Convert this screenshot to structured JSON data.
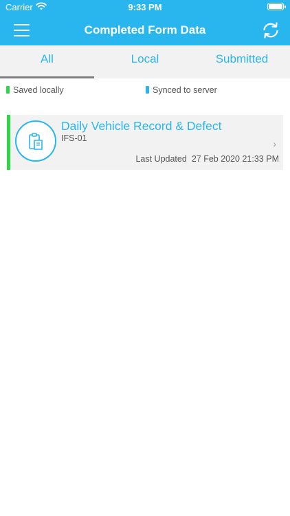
{
  "status_bar": {
    "carrier": "Carrier",
    "time": "9:33 PM"
  },
  "header": {
    "title": "Completed Form Data"
  },
  "tabs": [
    {
      "label": "All",
      "selected": true
    },
    {
      "label": "Local"
    },
    {
      "label": "Submitted"
    }
  ],
  "legend": {
    "local": {
      "label": "Saved locally",
      "color": "#2fd64a"
    },
    "server": {
      "label": "Synced to server",
      "color": "#29b6ee"
    }
  },
  "forms": [
    {
      "title": "Daily Vehicle Record & Defect",
      "code": "IFS-01",
      "updated_label": "Last Updated",
      "updated_value": "27 Feb 2020 21:33 PM",
      "status": "local"
    }
  ],
  "colors": {
    "accent": "#29b6ee",
    "local": "#2fd64a",
    "tab_background": "#f2f2f2"
  }
}
